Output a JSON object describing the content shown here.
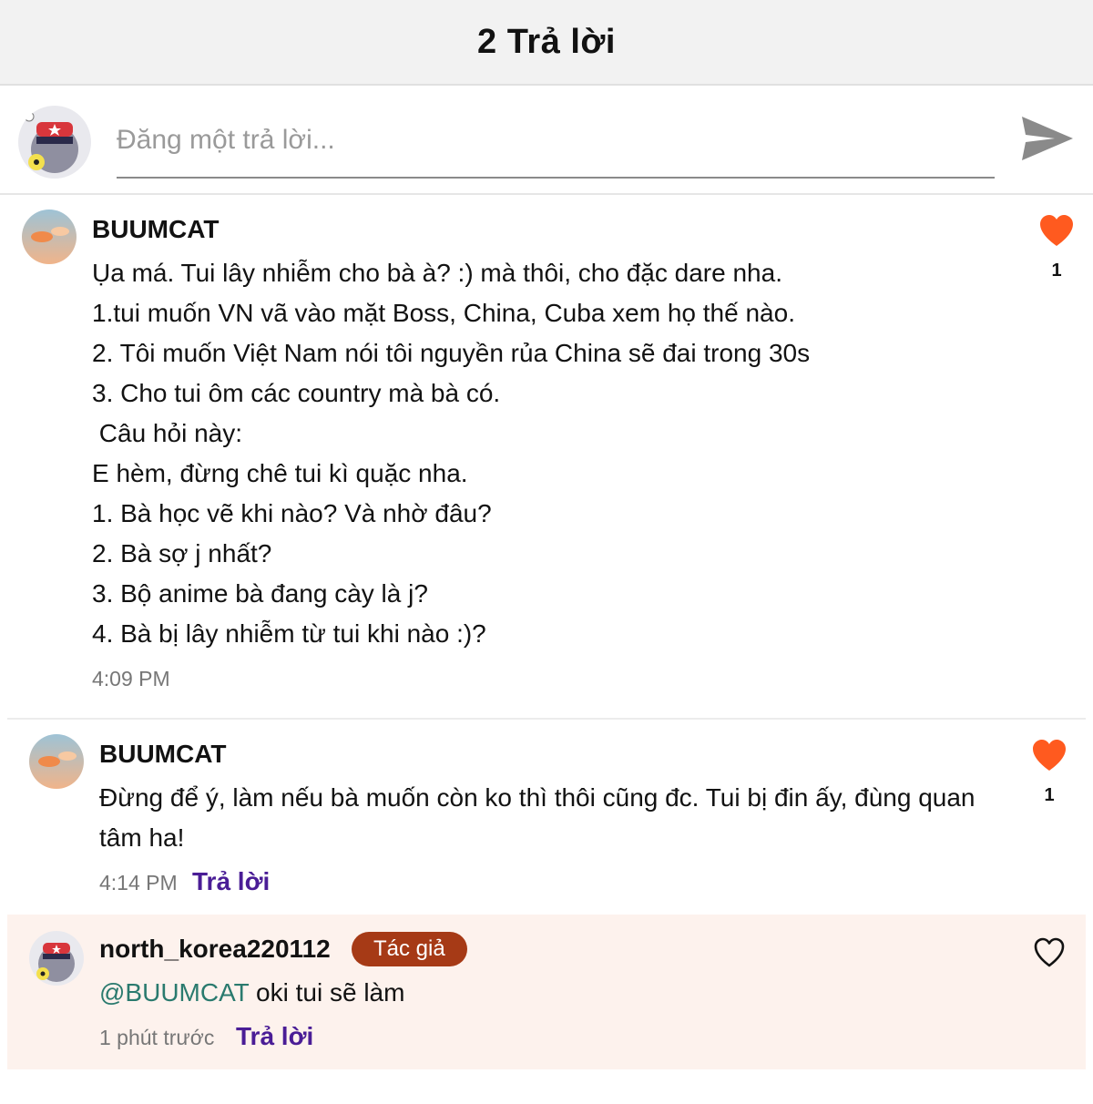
{
  "header": {
    "title": "2 Trả lời"
  },
  "composer": {
    "placeholder": "Đăng một trả lời...",
    "value": ""
  },
  "comments": [
    {
      "username": "BUUMCAT",
      "lines": [
        "Ụa má. Tui lây nhiễm cho bà à? :) mà thôi, cho đặc dare nha.",
        "1.tui muốn VN vã vào mặt Boss, China, Cuba xem họ thế nào.",
        "2. Tôi muốn Việt Nam nói tôi nguyền rủa China sẽ đai trong 30s",
        "3. Cho tui ôm các country mà bà có.",
        " Câu hỏi này:",
        "E hèm, đừng chê tui kì quặc nha.",
        "1. Bà học vẽ khi nào? Và nhờ đâu?",
        "2. Bà sợ j nhất?",
        "3. Bộ anime bà đang cày là j?",
        "4. Bà bị lây nhiễm từ tui khi nào :)?"
      ],
      "time": "4:09 PM",
      "likes": "1",
      "liked": true
    },
    {
      "username": "BUUMCAT",
      "lines": [
        "Đừng để ý, làm nếu bà muốn còn ko thì thôi cũng đc. Tui bị đin ấy, đùng quan",
        "tâm ha!"
      ],
      "time": "4:14 PM",
      "reply_label": "Trả lời",
      "likes": "1",
      "liked": true
    },
    {
      "username": "north_korea220112",
      "badge": "Tác giả",
      "mention": "@BUUMCAT",
      "text": " oki tui sẽ làm",
      "time": "1 phút trước",
      "reply_label": "Trả lời",
      "liked": false
    }
  ],
  "colors": {
    "like_active": "#ff5a1f",
    "reply_link": "#4a1d96",
    "author_badge": "#a63a16",
    "highlight_bg": "#fdf2ed",
    "mention": "#2a7a6e"
  },
  "icons": {
    "send": "send-icon",
    "like": "heart-icon",
    "like_outline": "heart-outline-icon"
  }
}
